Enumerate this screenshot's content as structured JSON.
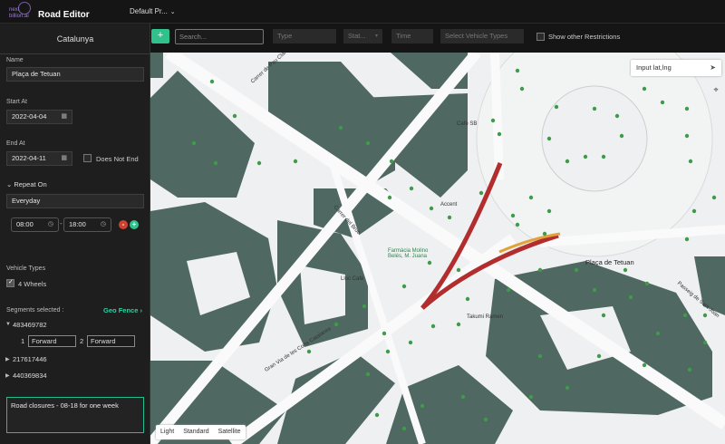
{
  "app": {
    "logo_line1": "next",
    "logo_line2": "billion.ai",
    "title": "Road Editor",
    "project": "Default Pr..."
  },
  "sidebar": {
    "region": "Catalunya",
    "name_label": "Name",
    "name_value": "Plaça de Tetuan",
    "start_label": "Start At",
    "start_value": "2022-04-04",
    "end_label": "End At",
    "end_value": "2022-04-11",
    "does_not_end_label": "Does Not End",
    "repeat_label": "Repeat On",
    "repeat_value": "Everyday",
    "time_from": "08:00",
    "time_separator": "-",
    "time_to": "18:00",
    "vehicle_types_label": "Vehicle Types",
    "vehicle_type": "4 Wheels",
    "segments_label": "Segments selected :",
    "geo_fence_label": "Geo Fence",
    "segments": [
      {
        "id": "483469782",
        "expanded": true
      },
      {
        "id": "217617446",
        "expanded": false
      },
      {
        "id": "440369834",
        "expanded": false
      }
    ],
    "segment_dir1_num": "1",
    "segment_dir1": "Forward",
    "segment_dir2_num": "2",
    "segment_dir2": "Forward",
    "notes": "Road closures - 08-18 for one week"
  },
  "toolbar": {
    "add_label": "+",
    "search_placeholder": "Search...",
    "type_placeholder": "Type",
    "status_placeholder": "Stat...",
    "time_placeholder": "Time",
    "vehicle_placeholder": "Select Vehicle Types",
    "show_other_label": "Show other Restrictions"
  },
  "map": {
    "latlng_placeholder": "Input lat,lng",
    "style_options": [
      "Light",
      "Standard",
      "Satellite"
    ],
    "labels": {
      "carrer_pau": "Carrer de Pau Claris",
      "carrer_bruc": "Carrer del Bruc",
      "placa_tetuan": "Plaça de Tetuan",
      "gran_via": "Gran Via de les Corts Catalanes",
      "passeig": "Passeig de Sant Joan",
      "farmacia": "Farmàcia Molino Belés, M. Juana",
      "lloc_cafe": "Lloc Cafe",
      "takumi": "Takumi Ramen",
      "accent": "Accent",
      "cafe_sb": "Cafè SB"
    },
    "colors": {
      "building": "#4f6862",
      "closure": "#b22e2e",
      "poi": "#3f9a4a",
      "background": "#eef0f1"
    }
  }
}
